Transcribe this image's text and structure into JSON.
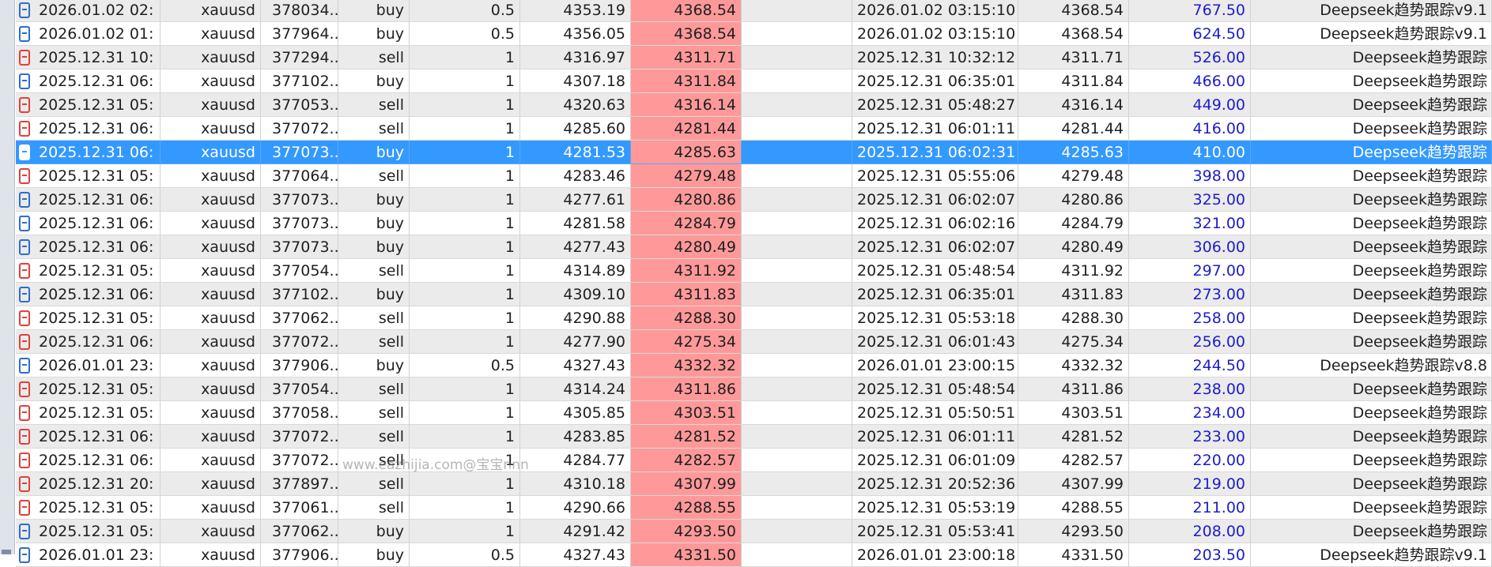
{
  "watermark": "www.eazhijia.com@宝宝nnn",
  "colors": {
    "buy_icon": "#2e6bcf",
    "sell_icon": "#e0403a",
    "highlight_price": "#ff9999",
    "profit_text": "#1c1ccc",
    "selected_row": "#3399ff"
  },
  "selected_index": 6,
  "rows": [
    {
      "type": "buy",
      "open_time": "2026.01.02 02:...",
      "symbol": "xauusd",
      "ticket": "378034...",
      "direction": "buy",
      "volume": "0.5",
      "open_price": "4353.19",
      "close_price": "4368.54",
      "blank": "",
      "close_time": "2026.01.02 03:15:10",
      "price": "4368.54",
      "profit": "767.50",
      "comment": "Deepseek趋势跟踪v9.1"
    },
    {
      "type": "buy",
      "open_time": "2026.01.02 01:...",
      "symbol": "xauusd",
      "ticket": "377964...",
      "direction": "buy",
      "volume": "0.5",
      "open_price": "4356.05",
      "close_price": "4368.54",
      "blank": "",
      "close_time": "2026.01.02 03:15:10",
      "price": "4368.54",
      "profit": "624.50",
      "comment": "Deepseek趋势跟踪v9.1"
    },
    {
      "type": "sell",
      "open_time": "2025.12.31 10:...",
      "symbol": "xauusd",
      "ticket": "377294...",
      "direction": "sell",
      "volume": "1",
      "open_price": "4316.97",
      "close_price": "4311.71",
      "blank": "",
      "close_time": "2025.12.31 10:32:12",
      "price": "4311.71",
      "profit": "526.00",
      "comment": "Deepseek趋势跟踪"
    },
    {
      "type": "buy",
      "open_time": "2025.12.31 06:...",
      "symbol": "xauusd",
      "ticket": "377102...",
      "direction": "buy",
      "volume": "1",
      "open_price": "4307.18",
      "close_price": "4311.84",
      "blank": "",
      "close_time": "2025.12.31 06:35:01",
      "price": "4311.84",
      "profit": "466.00",
      "comment": "Deepseek趋势跟踪"
    },
    {
      "type": "sell",
      "open_time": "2025.12.31 05:...",
      "symbol": "xauusd",
      "ticket": "377053...",
      "direction": "sell",
      "volume": "1",
      "open_price": "4320.63",
      "close_price": "4316.14",
      "blank": "",
      "close_time": "2025.12.31 05:48:27",
      "price": "4316.14",
      "profit": "449.00",
      "comment": "Deepseek趋势跟踪"
    },
    {
      "type": "sell",
      "open_time": "2025.12.31 06:...",
      "symbol": "xauusd",
      "ticket": "377072...",
      "direction": "sell",
      "volume": "1",
      "open_price": "4285.60",
      "close_price": "4281.44",
      "blank": "",
      "close_time": "2025.12.31 06:01:11",
      "price": "4281.44",
      "profit": "416.00",
      "comment": "Deepseek趋势跟踪"
    },
    {
      "type": "buy",
      "open_time": "2025.12.31 06:...",
      "symbol": "xauusd",
      "ticket": "377073...",
      "direction": "buy",
      "volume": "1",
      "open_price": "4281.53",
      "close_price": "4285.63",
      "blank": "",
      "close_time": "2025.12.31 06:02:31",
      "price": "4285.63",
      "profit": "410.00",
      "comment": "Deepseek趋势跟踪"
    },
    {
      "type": "sell",
      "open_time": "2025.12.31 05:...",
      "symbol": "xauusd",
      "ticket": "377064...",
      "direction": "sell",
      "volume": "1",
      "open_price": "4283.46",
      "close_price": "4279.48",
      "blank": "",
      "close_time": "2025.12.31 05:55:06",
      "price": "4279.48",
      "profit": "398.00",
      "comment": "Deepseek趋势跟踪"
    },
    {
      "type": "buy",
      "open_time": "2025.12.31 06:...",
      "symbol": "xauusd",
      "ticket": "377073...",
      "direction": "buy",
      "volume": "1",
      "open_price": "4277.61",
      "close_price": "4280.86",
      "blank": "",
      "close_time": "2025.12.31 06:02:07",
      "price": "4280.86",
      "profit": "325.00",
      "comment": "Deepseek趋势跟踪"
    },
    {
      "type": "buy",
      "open_time": "2025.12.31 06:...",
      "symbol": "xauusd",
      "ticket": "377073...",
      "direction": "buy",
      "volume": "1",
      "open_price": "4281.58",
      "close_price": "4284.79",
      "blank": "",
      "close_time": "2025.12.31 06:02:16",
      "price": "4284.79",
      "profit": "321.00",
      "comment": "Deepseek趋势跟踪"
    },
    {
      "type": "buy",
      "open_time": "2025.12.31 06:...",
      "symbol": "xauusd",
      "ticket": "377073...",
      "direction": "buy",
      "volume": "1",
      "open_price": "4277.43",
      "close_price": "4280.49",
      "blank": "",
      "close_time": "2025.12.31 06:02:07",
      "price": "4280.49",
      "profit": "306.00",
      "comment": "Deepseek趋势跟踪"
    },
    {
      "type": "sell",
      "open_time": "2025.12.31 05:...",
      "symbol": "xauusd",
      "ticket": "377054...",
      "direction": "sell",
      "volume": "1",
      "open_price": "4314.89",
      "close_price": "4311.92",
      "blank": "",
      "close_time": "2025.12.31 05:48:54",
      "price": "4311.92",
      "profit": "297.00",
      "comment": "Deepseek趋势跟踪"
    },
    {
      "type": "buy",
      "open_time": "2025.12.31 06:...",
      "symbol": "xauusd",
      "ticket": "377102...",
      "direction": "buy",
      "volume": "1",
      "open_price": "4309.10",
      "close_price": "4311.83",
      "blank": "",
      "close_time": "2025.12.31 06:35:01",
      "price": "4311.83",
      "profit": "273.00",
      "comment": "Deepseek趋势跟踪"
    },
    {
      "type": "sell",
      "open_time": "2025.12.31 05:...",
      "symbol": "xauusd",
      "ticket": "377062...",
      "direction": "sell",
      "volume": "1",
      "open_price": "4290.88",
      "close_price": "4288.30",
      "blank": "",
      "close_time": "2025.12.31 05:53:18",
      "price": "4288.30",
      "profit": "258.00",
      "comment": "Deepseek趋势跟踪"
    },
    {
      "type": "sell",
      "open_time": "2025.12.31 06:...",
      "symbol": "xauusd",
      "ticket": "377072...",
      "direction": "sell",
      "volume": "1",
      "open_price": "4277.90",
      "close_price": "4275.34",
      "blank": "",
      "close_time": "2025.12.31 06:01:43",
      "price": "4275.34",
      "profit": "256.00",
      "comment": "Deepseek趋势跟踪"
    },
    {
      "type": "buy",
      "open_time": "2026.01.01 23:...",
      "symbol": "xauusd",
      "ticket": "377906...",
      "direction": "buy",
      "volume": "0.5",
      "open_price": "4327.43",
      "close_price": "4332.32",
      "blank": "",
      "close_time": "2026.01.01 23:00:15",
      "price": "4332.32",
      "profit": "244.50",
      "comment": "Deepseek趋势跟踪v8.8"
    },
    {
      "type": "sell",
      "open_time": "2025.12.31 05:...",
      "symbol": "xauusd",
      "ticket": "377054...",
      "direction": "sell",
      "volume": "1",
      "open_price": "4314.24",
      "close_price": "4311.86",
      "blank": "",
      "close_time": "2025.12.31 05:48:54",
      "price": "4311.86",
      "profit": "238.00",
      "comment": "Deepseek趋势跟踪"
    },
    {
      "type": "sell",
      "open_time": "2025.12.31 05:...",
      "symbol": "xauusd",
      "ticket": "377058...",
      "direction": "sell",
      "volume": "1",
      "open_price": "4305.85",
      "close_price": "4303.51",
      "blank": "",
      "close_time": "2025.12.31 05:50:51",
      "price": "4303.51",
      "profit": "234.00",
      "comment": "Deepseek趋势跟踪"
    },
    {
      "type": "sell",
      "open_time": "2025.12.31 06:...",
      "symbol": "xauusd",
      "ticket": "377072...",
      "direction": "sell",
      "volume": "1",
      "open_price": "4283.85",
      "close_price": "4281.52",
      "blank": "",
      "close_time": "2025.12.31 06:01:11",
      "price": "4281.52",
      "profit": "233.00",
      "comment": "Deepseek趋势跟踪"
    },
    {
      "type": "sell",
      "open_time": "2025.12.31 06:...",
      "symbol": "xauusd",
      "ticket": "377072...",
      "direction": "sell",
      "volume": "1",
      "open_price": "4284.77",
      "close_price": "4282.57",
      "blank": "",
      "close_time": "2025.12.31 06:01:09",
      "price": "4282.57",
      "profit": "220.00",
      "comment": "Deepseek趋势跟踪"
    },
    {
      "type": "sell",
      "open_time": "2025.12.31 20:...",
      "symbol": "xauusd",
      "ticket": "377897...",
      "direction": "sell",
      "volume": "1",
      "open_price": "4310.18",
      "close_price": "4307.99",
      "blank": "",
      "close_time": "2025.12.31 20:52:36",
      "price": "4307.99",
      "profit": "219.00",
      "comment": "Deepseek趋势跟踪"
    },
    {
      "type": "sell",
      "open_time": "2025.12.31 05:...",
      "symbol": "xauusd",
      "ticket": "377061...",
      "direction": "sell",
      "volume": "1",
      "open_price": "4290.66",
      "close_price": "4288.55",
      "blank": "",
      "close_time": "2025.12.31 05:53:19",
      "price": "4288.55",
      "profit": "211.00",
      "comment": "Deepseek趋势跟踪"
    },
    {
      "type": "buy",
      "open_time": "2025.12.31 05:...",
      "symbol": "xauusd",
      "ticket": "377062...",
      "direction": "buy",
      "volume": "1",
      "open_price": "4291.42",
      "close_price": "4293.50",
      "blank": "",
      "close_time": "2025.12.31 05:53:41",
      "price": "4293.50",
      "profit": "208.00",
      "comment": "Deepseek趋势跟踪"
    },
    {
      "type": "buy",
      "open_time": "2026.01.01 23:...",
      "symbol": "xauusd",
      "ticket": "377906...",
      "direction": "buy",
      "volume": "0.5",
      "open_price": "4327.43",
      "close_price": "4331.50",
      "blank": "",
      "close_time": "2026.01.01 23:00:18",
      "price": "4331.50",
      "profit": "203.50",
      "comment": "Deepseek趋势跟踪v9.1"
    }
  ]
}
